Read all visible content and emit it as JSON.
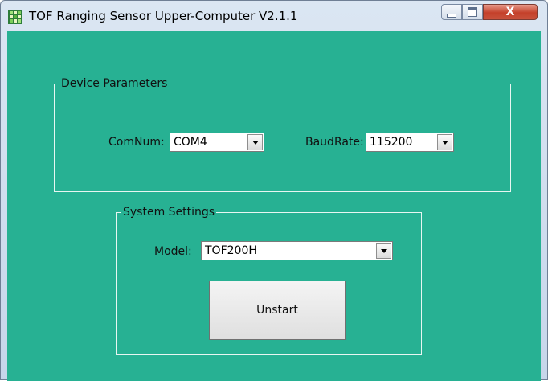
{
  "window": {
    "title": "TOF Ranging Sensor Upper-Computer V2.1.1"
  },
  "titlebar_controls": {
    "minimize_icon": "minimize-icon",
    "maximize_icon": "maximize-icon",
    "close_glyph": "X"
  },
  "device_parameters": {
    "legend": "Device Parameters",
    "com_label": "ComNum:",
    "com_value": "COM4",
    "baud_label": "BaudRate:",
    "baud_value": "115200"
  },
  "system_settings": {
    "legend": "System Settings",
    "model_label": "Model:",
    "model_value": "TOF200H",
    "start_button": "Unstart"
  },
  "colors": {
    "client_background": "#27b193",
    "close_button": "#c4402a"
  }
}
